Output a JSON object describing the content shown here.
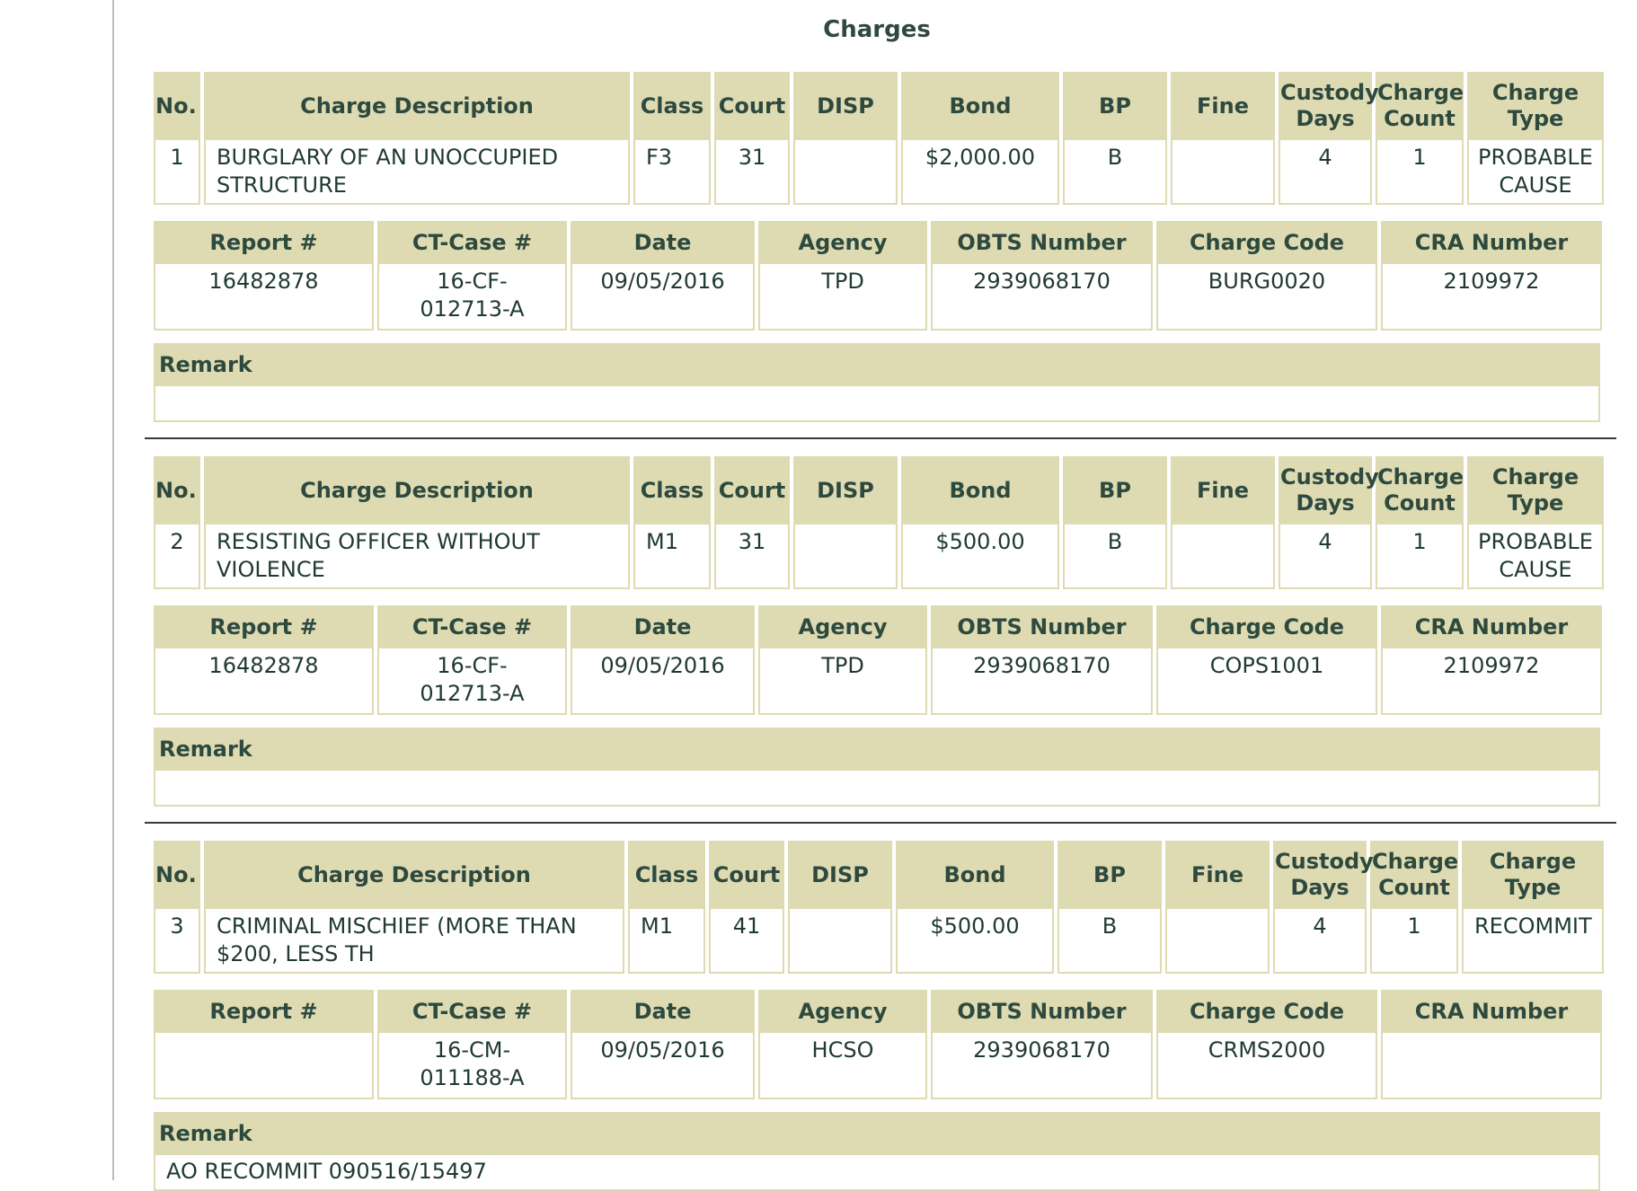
{
  "page_title": "Charges",
  "charge_headers": {
    "no": "No.",
    "description": "Charge Description",
    "class": "Class",
    "court": "Court",
    "disp": "DISP",
    "bond": "Bond",
    "bp": "BP",
    "fine": "Fine",
    "custody_days": "Custody Days",
    "charge_count": "Charge Count",
    "charge_type": "Charge Type"
  },
  "report_headers": {
    "report": "Report #",
    "ct_case": "CT-Case #",
    "date": "Date",
    "agency": "Agency",
    "obts": "OBTS Number",
    "charge_code": "Charge Code",
    "cra": "CRA Number"
  },
  "remark_header": "Remark",
  "charges": [
    {
      "no": "1",
      "description": "BURGLARY OF AN UNOCCUPIED STRUCTURE",
      "class": "F3",
      "court": "31",
      "disp": "",
      "bond": "$2,000.00",
      "bp": "B",
      "fine": "",
      "custody_days": "4",
      "charge_count": "1",
      "charge_type": "PROBABLE CAUSE",
      "report": "16482878",
      "ct_case": "16-CF-012713-A",
      "date": "09/05/2016",
      "agency": "TPD",
      "obts": "2939068170",
      "charge_code": "BURG0020",
      "cra": "2109972",
      "remark": ""
    },
    {
      "no": "2",
      "description": "RESISTING OFFICER WITHOUT VIOLENCE",
      "class": "M1",
      "court": "31",
      "disp": "",
      "bond": "$500.00",
      "bp": "B",
      "fine": "",
      "custody_days": "4",
      "charge_count": "1",
      "charge_type": "PROBABLE CAUSE",
      "report": "16482878",
      "ct_case": "16-CF-012713-A",
      "date": "09/05/2016",
      "agency": "TPD",
      "obts": "2939068170",
      "charge_code": "COPS1001",
      "cra": "2109972",
      "remark": ""
    },
    {
      "no": "3",
      "description": "CRIMINAL MISCHIEF (MORE THAN $200, LESS TH",
      "class": "M1",
      "court": "41",
      "disp": "",
      "bond": "$500.00",
      "bp": "B",
      "fine": "",
      "custody_days": "4",
      "charge_count": "1",
      "charge_type": "RECOMMIT",
      "report": "",
      "ct_case": "16-CM-011188-A",
      "date": "09/05/2016",
      "agency": "HCSO",
      "obts": "2939068170",
      "charge_code": "CRMS2000",
      "cra": "",
      "remark": "AO RECOMMIT 090516/15497"
    }
  ]
}
